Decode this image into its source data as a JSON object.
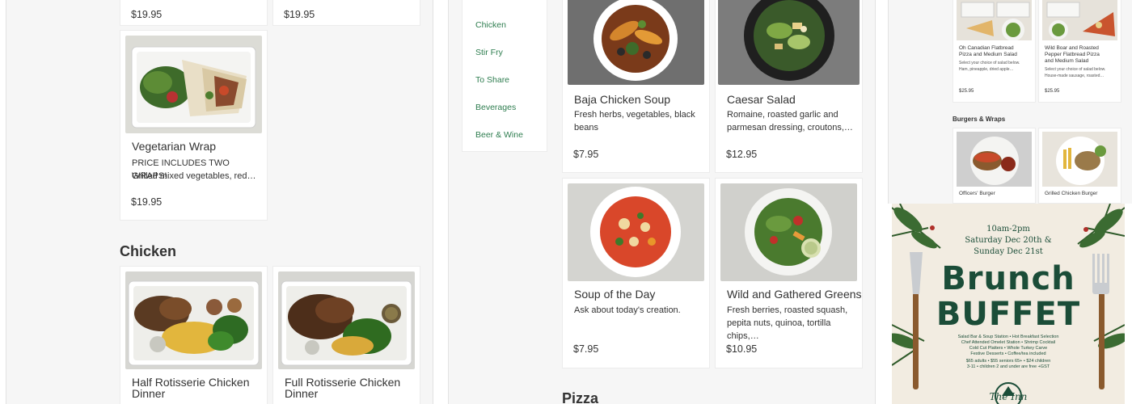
{
  "left_column": {
    "top_prices": [
      "$19.95",
      "$19.95"
    ],
    "vegetarian_wrap": {
      "title": "Vegetarian Wrap",
      "desc_line1": "PRICE INCLUDES TWO WRAPS!",
      "desc_line2": "Grilled mixed vegetables, red…",
      "price": "$19.95"
    },
    "chicken_heading": "Chicken",
    "half_chicken": {
      "title_line1": "Half Rotisserie Chicken",
      "title_line2": "Dinner"
    },
    "full_chicken": {
      "title_line1": "Full Rotisserie Chicken",
      "title_line2": "Dinner"
    }
  },
  "middle_column": {
    "category_nav": [
      "Chicken",
      "Stir Fry",
      "To Share",
      "Beverages",
      "Beer & Wine"
    ],
    "items": [
      {
        "title": "Baja Chicken Soup",
        "desc_line1": "Fresh herbs, vegetables, black",
        "desc_line2": "beans",
        "price": "$7.95"
      },
      {
        "title": "Caesar Salad",
        "desc_line1": "Romaine, roasted garlic and",
        "desc_line2": "parmesan dressing, croutons,…",
        "price": "$12.95"
      },
      {
        "title": "Soup of the Day",
        "desc_line1": "Ask about today's creation.",
        "desc_line2": "",
        "price": "$7.95"
      },
      {
        "title": "Wild and Gathered Greens",
        "desc_line1": "Fresh berries, roasted squash,",
        "desc_line2": "pepita nuts, quinoa, tortilla chips,…",
        "price": "$10.95"
      }
    ],
    "pizza_heading": "Pizza"
  },
  "right_column": {
    "pizza_cards": [
      {
        "title_line1": "Oh Canadian Flatbread",
        "title_line2": "Pizza and Medium Salad",
        "title_line3": "",
        "desc_line1": "Select your choice of salad below.",
        "desc_line2": "Ham, pineapple, dried apple…",
        "price": "$25.95"
      },
      {
        "title_line1": "Wild Boar and Roasted",
        "title_line2": "Pepper Flatbread Pizza",
        "title_line3": "and Medium Salad",
        "desc_line1": "Select your choice of salad below.",
        "desc_line2": "House-made sausage, roasted…",
        "price": "$25.95"
      }
    ],
    "burgers_heading": "Burgers & Wraps",
    "burger_cards": [
      "Officers' Burger",
      "Grilled Chicken Burger"
    ]
  },
  "ad": {
    "time": "10am-2pm",
    "date_line1": "Saturday Dec 20th &",
    "date_line2": "Sunday Dec 21st",
    "headline1": "Brunch",
    "headline2": "BUFFET",
    "details_line1": "Salad Bar & Soup Station • Hot Breakfast Selection",
    "details_line2": "Chef Attended Omelet Station • Shrimp Cocktail",
    "details_line3": "Cold Cut Platters • Whole Turkey Carve",
    "details_line4": "Festive Desserts • Coffee/tea included",
    "price_line1": "$65 adults • $55 seniors 65+ • $24 children",
    "price_line2": "3-11 • children 2 and under are free +GST",
    "logo_text": "The Inn"
  },
  "colors": {
    "accent_green": "#2e7d4f",
    "ad_dark_green": "#1b4d38",
    "ad_bg": "#f2ece1"
  }
}
